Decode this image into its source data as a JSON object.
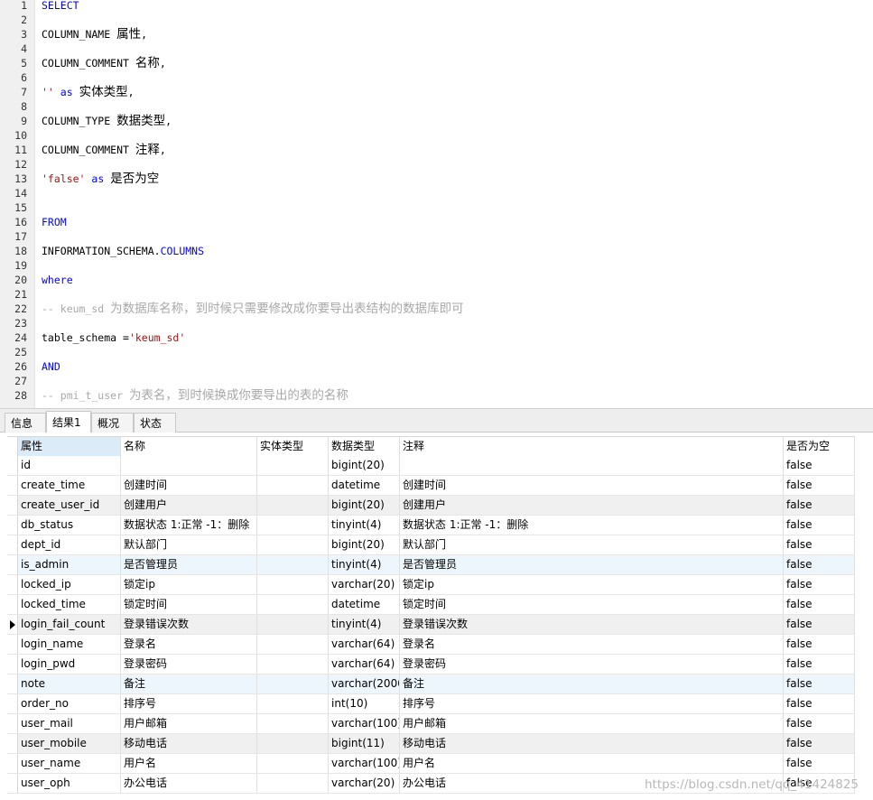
{
  "editor": {
    "lines": [
      {
        "n": "1",
        "tokens": [
          {
            "t": "SELECT",
            "c": "t-kw"
          }
        ]
      },
      {
        "n": "2",
        "tokens": []
      },
      {
        "n": "3",
        "tokens": [
          {
            "t": "COLUMN_NAME ",
            "c": ""
          },
          {
            "t": "属性",
            "c": "t-zh"
          },
          {
            "t": ",",
            "c": ""
          }
        ]
      },
      {
        "n": "4",
        "tokens": []
      },
      {
        "n": "5",
        "tokens": [
          {
            "t": "COLUMN_COMMENT ",
            "c": ""
          },
          {
            "t": "名称",
            "c": "t-zh"
          },
          {
            "t": ",",
            "c": ""
          }
        ]
      },
      {
        "n": "6",
        "tokens": []
      },
      {
        "n": "7",
        "tokens": [
          {
            "t": "''",
            "c": "t-str"
          },
          {
            "t": " ",
            "c": ""
          },
          {
            "t": "as",
            "c": "t-kw"
          },
          {
            "t": " ",
            "c": ""
          },
          {
            "t": "实体类型",
            "c": "t-zh"
          },
          {
            "t": ",",
            "c": ""
          }
        ]
      },
      {
        "n": "8",
        "tokens": []
      },
      {
        "n": "9",
        "tokens": [
          {
            "t": "COLUMN_TYPE ",
            "c": ""
          },
          {
            "t": "数据类型",
            "c": "t-zh"
          },
          {
            "t": ",",
            "c": ""
          }
        ]
      },
      {
        "n": "10",
        "tokens": []
      },
      {
        "n": "11",
        "tokens": [
          {
            "t": "COLUMN_COMMENT ",
            "c": ""
          },
          {
            "t": "注释",
            "c": "t-zh"
          },
          {
            "t": ",",
            "c": ""
          }
        ]
      },
      {
        "n": "12",
        "tokens": []
      },
      {
        "n": "13",
        "tokens": [
          {
            "t": "'false'",
            "c": "t-str"
          },
          {
            "t": " ",
            "c": ""
          },
          {
            "t": "as",
            "c": "t-kw"
          },
          {
            "t": " ",
            "c": ""
          },
          {
            "t": "是否为空",
            "c": "t-zh"
          }
        ]
      },
      {
        "n": "14",
        "tokens": []
      },
      {
        "n": "15",
        "tokens": []
      },
      {
        "n": "16",
        "tokens": [
          {
            "t": "FROM",
            "c": "t-kw"
          }
        ]
      },
      {
        "n": "17",
        "tokens": []
      },
      {
        "n": "18",
        "tokens": [
          {
            "t": "INFORMATION_SCHEMA.",
            "c": ""
          },
          {
            "t": "COLUMNS",
            "c": "t-kw"
          }
        ]
      },
      {
        "n": "19",
        "tokens": []
      },
      {
        "n": "20",
        "tokens": [
          {
            "t": "where",
            "c": "t-kw"
          }
        ]
      },
      {
        "n": "21",
        "tokens": []
      },
      {
        "n": "22",
        "tokens": [
          {
            "t": "-- keum_sd ",
            "c": "t-com"
          },
          {
            "t": "为数据库名称，到时候只需要修改成你要导出表结构的数据库即可",
            "c": "t-com t-zh"
          }
        ]
      },
      {
        "n": "23",
        "tokens": []
      },
      {
        "n": "24",
        "tokens": [
          {
            "t": "table_schema =",
            "c": ""
          },
          {
            "t": "'keum_sd'",
            "c": "t-str"
          }
        ]
      },
      {
        "n": "25",
        "tokens": []
      },
      {
        "n": "26",
        "tokens": [
          {
            "t": "AND",
            "c": "t-kw"
          }
        ]
      },
      {
        "n": "27",
        "tokens": []
      },
      {
        "n": "28",
        "tokens": [
          {
            "t": "-- pmi_t_user ",
            "c": "t-com"
          },
          {
            "t": "为表名，到时候换成你要导出的表的名称",
            "c": "t-com t-zh"
          }
        ]
      }
    ]
  },
  "tabs": [
    {
      "label": "信息",
      "active": false
    },
    {
      "label": "结果1",
      "active": true
    },
    {
      "label": "概况",
      "active": false
    },
    {
      "label": "状态",
      "active": false
    }
  ],
  "grid": {
    "columns": [
      "属性",
      "名称",
      "实体类型",
      "数据类型",
      "注释",
      "是否为空"
    ],
    "rows": [
      [
        "id",
        "",
        "",
        "bigint(20)",
        "",
        "false"
      ],
      [
        "create_time",
        "创建时间",
        "",
        "datetime",
        "创建时间",
        "false"
      ],
      [
        "create_user_id",
        "创建用户",
        "",
        "bigint(20)",
        "创建用户",
        "false"
      ],
      [
        "db_status",
        "数据状态 1:正常  -1：删除",
        "",
        "tinyint(4)",
        "数据状态 1:正常  -1：删除",
        "false"
      ],
      [
        "dept_id",
        "默认部门",
        "",
        "bigint(20)",
        "默认部门",
        "false"
      ],
      [
        "is_admin",
        "是否管理员",
        "",
        "tinyint(4)",
        "是否管理员",
        "false"
      ],
      [
        "locked_ip",
        "锁定ip",
        "",
        "varchar(20)",
        "锁定ip",
        "false"
      ],
      [
        "locked_time",
        "锁定时间",
        "",
        "datetime",
        "锁定时间",
        "false"
      ],
      [
        "login_fail_count",
        "登录错误次数",
        "",
        "tinyint(4)",
        "登录错误次数",
        "false"
      ],
      [
        "login_name",
        "登录名",
        "",
        "varchar(64)",
        "登录名",
        "false"
      ],
      [
        "login_pwd",
        "登录密码",
        "",
        "varchar(64)",
        "登录密码",
        "false"
      ],
      [
        "note",
        "备注",
        "",
        "varchar(2000",
        "备注",
        "false"
      ],
      [
        "order_no",
        "排序号",
        "",
        "int(10)",
        "排序号",
        "false"
      ],
      [
        "user_mail",
        "用户邮箱",
        "",
        "varchar(100)",
        "用户邮箱",
        "false"
      ],
      [
        "user_mobile",
        "移动电话",
        "",
        "bigint(11)",
        "移动电话",
        "false"
      ],
      [
        "user_name",
        "用户名",
        "",
        "varchar(100)",
        "用户名",
        "false"
      ],
      [
        "user_oph",
        "办公电话",
        "",
        "varchar(20)",
        "办公电话",
        "false"
      ]
    ],
    "current_row": 8
  },
  "watermark": "https://blog.csdn.net/qq_41424825"
}
